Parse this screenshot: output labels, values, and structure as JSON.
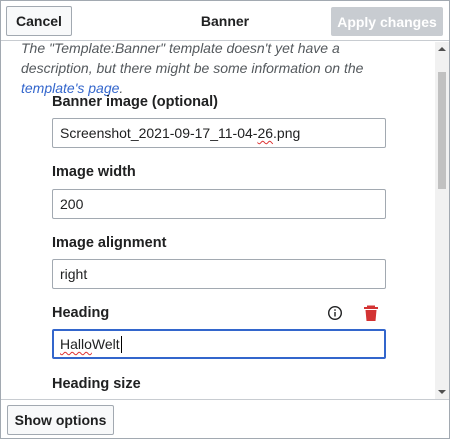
{
  "header": {
    "cancel_label": "Cancel",
    "title": "Banner",
    "apply_label": "Apply changes"
  },
  "description": {
    "text_before": "The \"Template:Banner\" template doesn't yet have a description, but there might be some information on the ",
    "link_text": "template's page",
    "text_after": "."
  },
  "fields": {
    "banner_image": {
      "label": "Banner image (optional)",
      "value_prefix": "Screenshot_2021-09-17_11-04-",
      "value_misspelled": "26",
      "value_suffix": ".png"
    },
    "image_width": {
      "label": "Image width",
      "value": "200"
    },
    "image_alignment": {
      "label": "Image alignment",
      "value": "right"
    },
    "heading": {
      "label": "Heading",
      "value_misspelled": "Hallo",
      "value_rest": " Welt"
    },
    "heading_size": {
      "label": "Heading size"
    }
  },
  "icons": {
    "info": "info-icon",
    "delete": "trash-icon",
    "delete_color": "#d33333"
  },
  "footer": {
    "show_options_label": "Show options"
  },
  "colors": {
    "link": "#3366cc",
    "focus_border": "#3366cc",
    "disabled_button": "#c8ccd1"
  }
}
